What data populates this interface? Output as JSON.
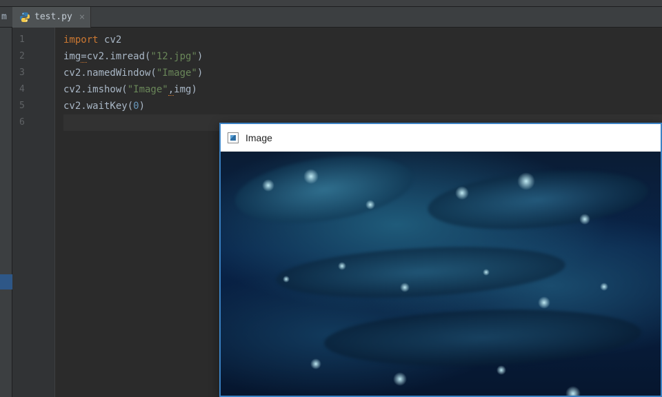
{
  "left_fragment": "m",
  "tab": {
    "name": "test.py",
    "close_glyph": "×"
  },
  "gutter": [
    "1",
    "2",
    "3",
    "4",
    "5",
    "6"
  ],
  "code": {
    "l1": {
      "kw": "import ",
      "ident": "cv2"
    },
    "l2": {
      "a": "img",
      "b": "=",
      "c": "cv2.imread(",
      "str": "\"12.jpg\"",
      "d": ")"
    },
    "l3": {
      "a": "cv2.namedWindow(",
      "str": "\"Image\"",
      "b": ")"
    },
    "l4": {
      "a": "cv2.imshow(",
      "str": "\"Image\"",
      "b": ",",
      "c": "img)"
    },
    "l5": {
      "a": "cv2.waitKey(",
      "num": "0",
      "b": ")"
    }
  },
  "image_window": {
    "title": "Image"
  }
}
